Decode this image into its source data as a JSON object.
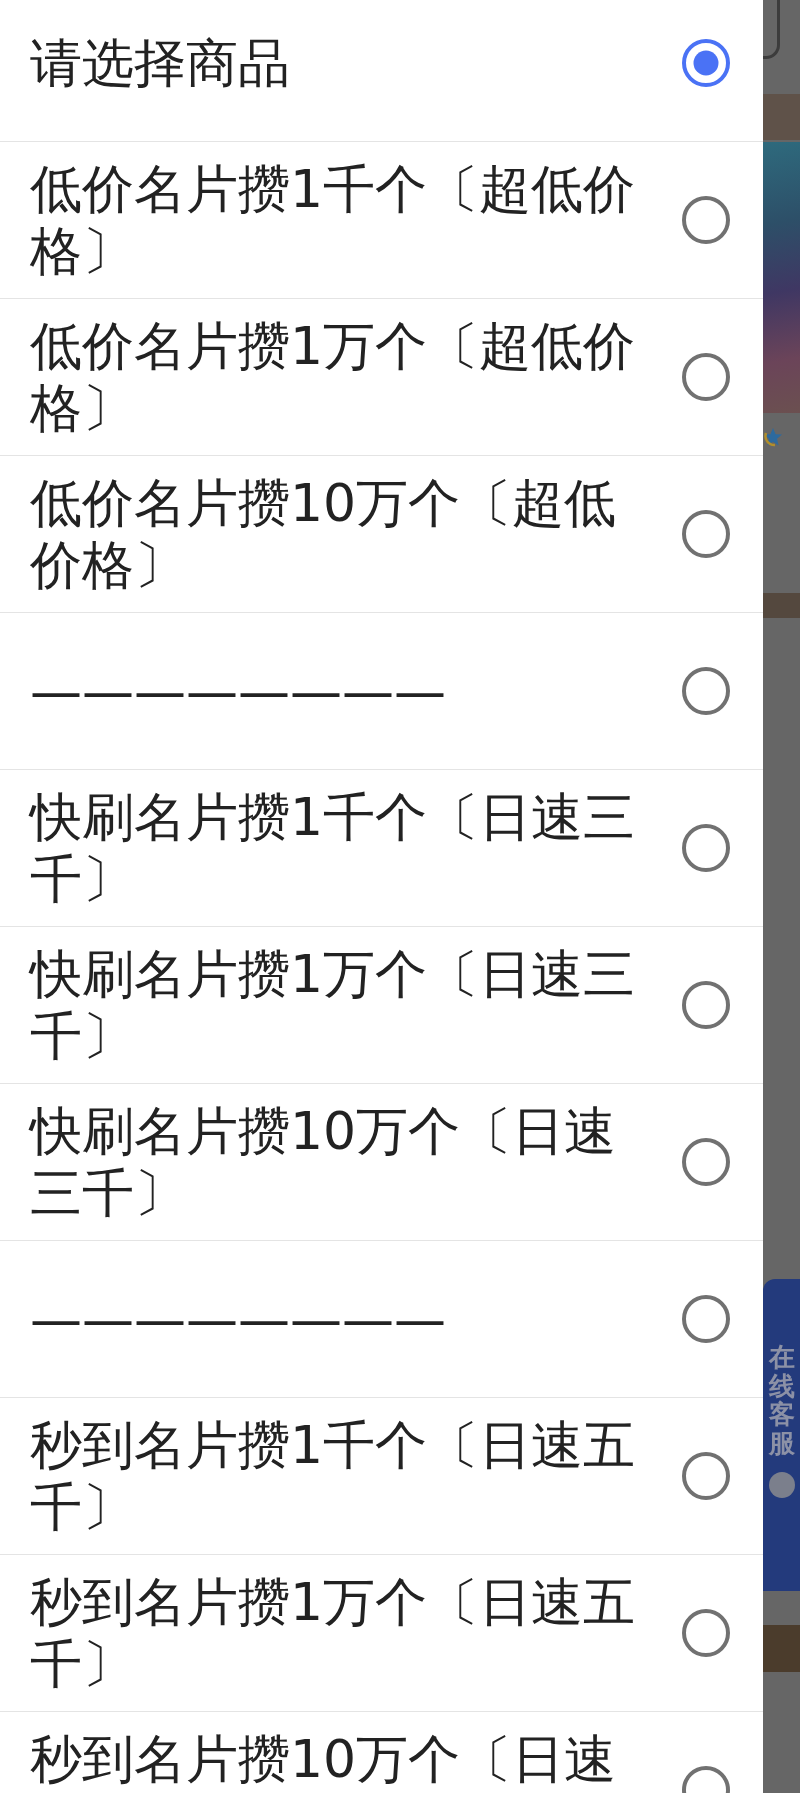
{
  "dropdown": {
    "options": [
      {
        "label": "请选择商品",
        "selected": true
      },
      {
        "label": "低价名片攒1千个〔超低价格〕",
        "selected": false
      },
      {
        "label": "低价名片攒1万个〔超低价格〕",
        "selected": false
      },
      {
        "label": "低价名片攒10万个〔超低价格〕",
        "selected": false
      },
      {
        "label": "————————",
        "selected": false
      },
      {
        "label": "快刷名片攒1千个〔日速三千〕",
        "selected": false
      },
      {
        "label": "快刷名片攒1万个〔日速三千〕",
        "selected": false
      },
      {
        "label": "快刷名片攒10万个〔日速三千〕",
        "selected": false
      },
      {
        "label": "————————",
        "selected": false
      },
      {
        "label": "秒到名片攒1千个〔日速五千〕",
        "selected": false
      },
      {
        "label": "秒到名片攒1万个〔日速五千〕",
        "selected": false
      },
      {
        "label": "秒到名片攒10万个〔日速",
        "selected": false
      }
    ]
  },
  "background": {
    "customer_service_tab": {
      "label": "在线客服"
    }
  }
}
